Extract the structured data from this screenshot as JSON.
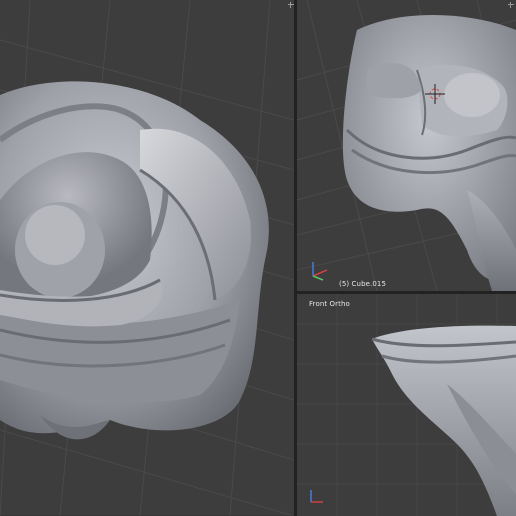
{
  "viewports": {
    "left": {
      "name": "perspective viewport"
    },
    "top_right": {
      "object_label": "(5) Cube.015"
    },
    "bottom_right": {
      "view_label": "Front Ortho"
    }
  },
  "colors": {
    "background": "#3d3d3d",
    "grid": "#4a4a4a",
    "mesh": "#a5a7b0",
    "divider": "#222222",
    "axis_x": "#d04040",
    "axis_y": "#60c060",
    "axis_z": "#4a7bd8"
  }
}
